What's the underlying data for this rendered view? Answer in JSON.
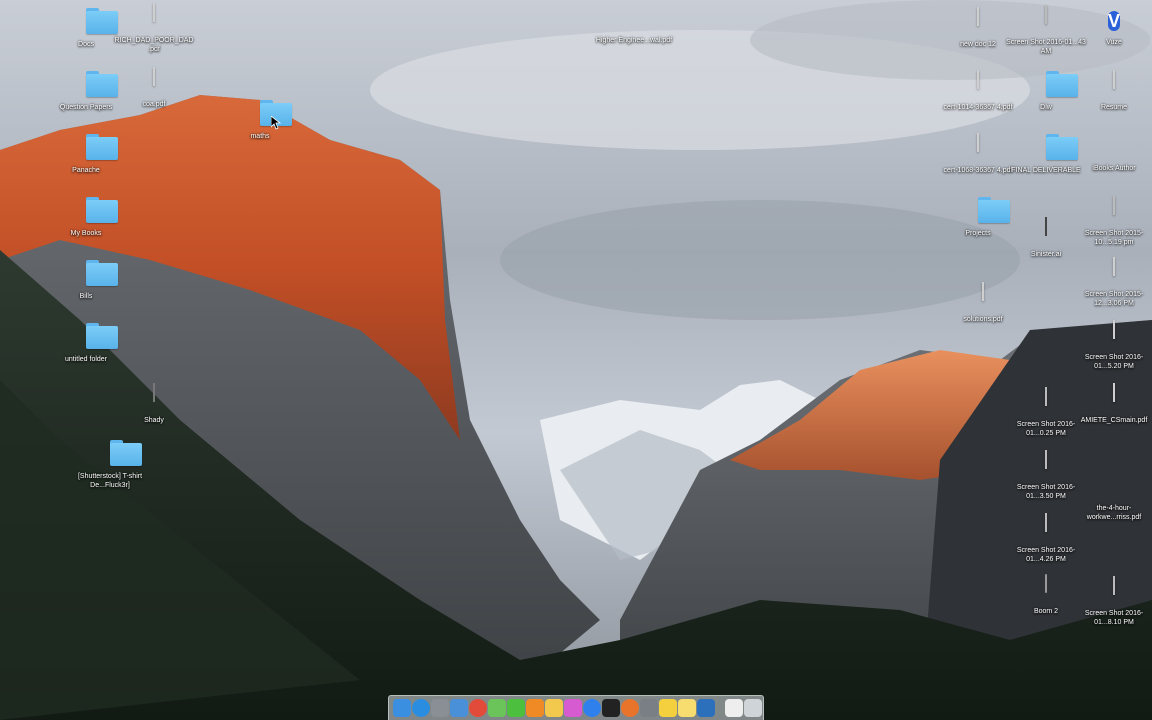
{
  "desktop": {
    "left_icons": [
      {
        "name": "Docs",
        "kind": "folder"
      },
      {
        "name": "RICH_DAD_POOR_DAD.pdf",
        "kind": "doc"
      },
      {
        "name": "Question Papers",
        "kind": "folder"
      },
      {
        "name": "coa.pdf",
        "kind": "doc"
      },
      {
        "name": "maths",
        "kind": "folder"
      },
      {
        "name": "Panache",
        "kind": "folder"
      },
      {
        "name": "My Books",
        "kind": "folder"
      },
      {
        "name": "Bills",
        "kind": "folder"
      },
      {
        "name": "untitled folder",
        "kind": "folder"
      },
      {
        "name": "Shady",
        "kind": "image"
      },
      {
        "name": "[Shutterstock] T-shirt De...Fluck3r]",
        "kind": "folder"
      }
    ],
    "center_icons": [
      {
        "name": "Higher Enginee...wal.pdf",
        "kind": "film"
      }
    ],
    "right_icons": [
      {
        "name": "new doc 12",
        "kind": "doc"
      },
      {
        "name": "Screen Shot 2016-01...43 AM",
        "kind": "shot"
      },
      {
        "name": "Vuze",
        "kind": "app"
      },
      {
        "name": "cert-1014-36367 4.pdf",
        "kind": "doc"
      },
      {
        "name": "Dlw",
        "kind": "folder"
      },
      {
        "name": "Resume",
        "kind": "doc"
      },
      {
        "name": "cert-1068-36367 4.pdf",
        "kind": "doc"
      },
      {
        "name": "FINAL DELIVERABLE",
        "kind": "folder"
      },
      {
        "name": "iBooks Author",
        "kind": "app"
      },
      {
        "name": "Projects",
        "kind": "folder"
      },
      {
        "name": "Sinister.ai",
        "kind": "dark"
      },
      {
        "name": "Screen Shot 2015-10...5.19 pm",
        "kind": "shot"
      },
      {
        "name": "solutions.pdf",
        "kind": "doc"
      },
      {
        "name": "Screen Shot 2015-12...3.06 PM",
        "kind": "doc"
      },
      {
        "name": "Screen Shot 2016-01...5.20 PM",
        "kind": "doc"
      },
      {
        "name": "Screen Shot 2016-01...0.25 PM",
        "kind": "shot"
      },
      {
        "name": "AMIETE_CSmain.pdf",
        "kind": "doc"
      },
      {
        "name": "Screen Shot 2016-01...3.50 PM",
        "kind": "shot"
      },
      {
        "name": "the-4-hour-workwe...rriss.pdf",
        "kind": "orange"
      },
      {
        "name": "Screen Shot 2016-01...4.26 PM",
        "kind": "shot"
      },
      {
        "name": "Boom 2",
        "kind": "drive"
      },
      {
        "name": "Screen Shot 2016-01...8.10 PM",
        "kind": "shot"
      }
    ]
  },
  "dock": {
    "items": [
      "finder-icon",
      "safari-icon",
      "launchpad-icon",
      "preview-icon",
      "chrome-icon",
      "messages-icon",
      "facetime-icon",
      "ibooks-icon",
      "photos-icon",
      "itunes-icon",
      "app-store-icon",
      "terminal-icon",
      "firefox-icon",
      "system-preferences-icon",
      "notes-icon",
      "stickies-icon",
      "utility-icon",
      "downloads-icon",
      "trash-icon"
    ],
    "colors": [
      "#3b8fe0",
      "#2b8de0",
      "#8a8f96",
      "#4a90d9",
      "#e24a3a",
      "#6ac45a",
      "#4cbf3f",
      "#f08a24",
      "#f2c94c",
      "#d65bd0",
      "#2f80ed",
      "#222222",
      "#e8742c",
      "#7a7f85",
      "#f4d03f",
      "#f7dc6f",
      "#2c6fbb",
      "#eeeeee",
      "#cfd4d8"
    ]
  }
}
